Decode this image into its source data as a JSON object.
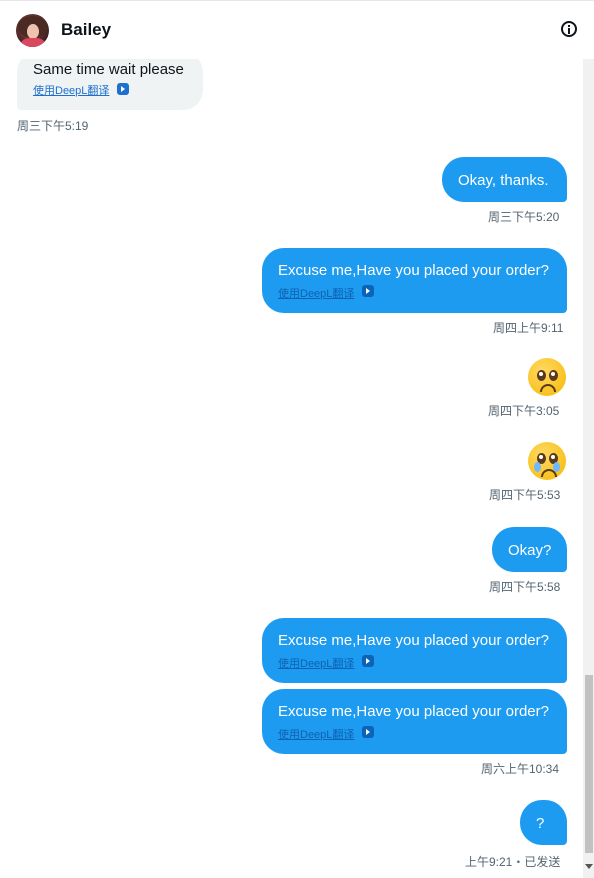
{
  "header": {
    "title": "Bailey",
    "avatar_icon": "avatar",
    "info_icon": "info-icon"
  },
  "messages": {
    "m1": {
      "text": "Same time wait please",
      "translate": "使用DeepL翻译",
      "time": "周三下午5:19"
    },
    "m2": {
      "text": "Okay, thanks.",
      "time": "周三下午5:20"
    },
    "m3": {
      "text": "Excuse me,Have you placed your order?",
      "translate": "使用DeepL翻译",
      "time": "周四上午9:11"
    },
    "m4": {
      "emoji": "pleading-face-emoji",
      "time": "周四下午3:05"
    },
    "m5": {
      "emoji": "face-holding-back-tears-emoji",
      "time": "周四下午5:53"
    },
    "m6": {
      "text": "Okay?",
      "time": "周四下午5:58"
    },
    "m7": {
      "text": "Excuse me,Have you placed your order?",
      "translate": "使用DeepL翻译"
    },
    "m8": {
      "text": "Excuse me,Have you placed your order?",
      "translate": "使用DeepL翻译",
      "time": "周六上午10:34"
    },
    "m9": {
      "text": "?",
      "time": "上午9:21・已发送"
    }
  },
  "colors": {
    "sent_bubble": "#1d9bf0",
    "received_bubble": "#eff3f4",
    "timestamp": "#536471"
  }
}
